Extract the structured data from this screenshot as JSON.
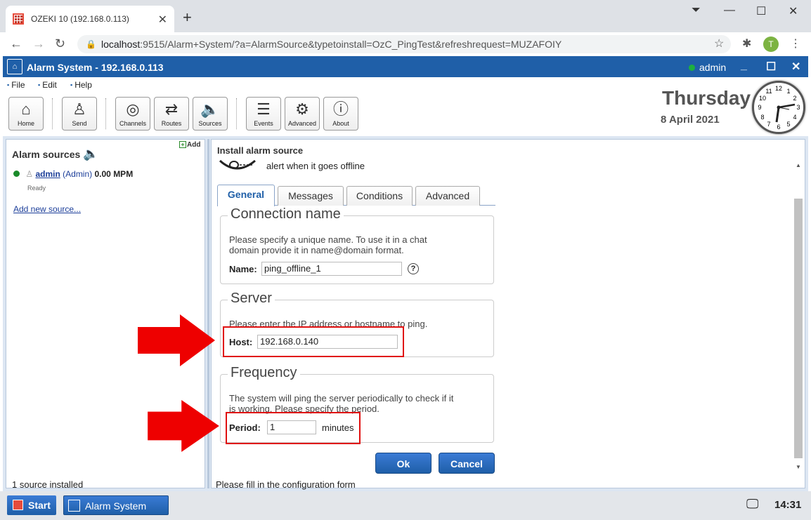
{
  "browser": {
    "tab_title": "OZEKI 10 (192.168.0.113)",
    "url_host": "localhost",
    "url_rest": ":9515/Alarm+System/?a=AlarmSource&typetoinstall=OzC_PingTest&refreshrequest=MUZAFOIY",
    "profile_initial": "T"
  },
  "app": {
    "title": "Alarm System - 192.168.0.113",
    "user": "admin",
    "menu": [
      "File",
      "Edit",
      "Help"
    ],
    "toolbar": [
      {
        "label": "Home",
        "icon": "home-icon",
        "glyph": "⌂"
      },
      {
        "label": "Send",
        "icon": "send-icon",
        "glyph": "♙"
      },
      {
        "label": "Channels",
        "icon": "channels-icon",
        "glyph": "◎"
      },
      {
        "label": "Routes",
        "icon": "routes-icon",
        "glyph": "⇄"
      },
      {
        "label": "Sources",
        "icon": "sources-icon",
        "glyph": "🔈"
      },
      {
        "label": "Events",
        "icon": "events-icon",
        "glyph": "☰"
      },
      {
        "label": "Advanced",
        "icon": "gear-icon",
        "glyph": "⚙"
      },
      {
        "label": "About",
        "icon": "info-icon",
        "glyph": "ⓘ"
      }
    ],
    "day": "Thursday",
    "date": "8 April 2021",
    "clock_numbers": [
      "12",
      "1",
      "2",
      "3",
      "4",
      "5",
      "6",
      "7",
      "8",
      "9",
      "10",
      "11"
    ]
  },
  "left_panel": {
    "title": "Alarm sources",
    "add_label": "Add",
    "source": {
      "name": "admin",
      "role": "(Admin)",
      "rate": "0.00 MPM",
      "status": "Ready"
    },
    "add_new_link": "Add new source...",
    "footer": "1 source installed"
  },
  "right_panel": {
    "title": "Install alarm source",
    "description": "alert when it goes offline",
    "tabs": [
      "General",
      "Messages",
      "Conditions",
      "Advanced"
    ],
    "active_tab": "General",
    "connection": {
      "heading": "Connection name",
      "desc_line1": "Please specify a unique name. To use it in a chat",
      "desc_line2": "domain provide it in name@domain format.",
      "label": "Name:",
      "value": "ping_offline_1",
      "help": "?"
    },
    "server": {
      "heading": "Server",
      "desc": "Please enter the IP address or hostname to ping.",
      "label": "Host:",
      "value": "192.168.0.140"
    },
    "frequency": {
      "heading": "Frequency",
      "desc_line1": "The system will ping the server periodically to check if it",
      "desc_line2": "is working. Please specify the period.",
      "label": "Period:",
      "value": "1",
      "unit": "minutes"
    },
    "ok_label": "Ok",
    "cancel_label": "Cancel",
    "footer": "Please fill in the configuration form"
  },
  "taskbar": {
    "start_label": "Start",
    "app_label": "Alarm System",
    "time": "14:31"
  },
  "colors": {
    "accent": "#1f5fa8",
    "highlight": "#e01010",
    "online": "#1a8a2a"
  }
}
